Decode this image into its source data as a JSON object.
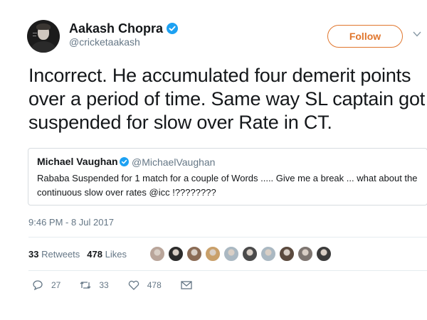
{
  "author": {
    "name": "Aakash Chopra",
    "handle": "@cricketaakash",
    "follow_label": "Follow"
  },
  "tweet": {
    "text": "Incorrect. He accumulated four demerit points over a period of time. Same way SL captain got suspended for slow over Rate in CT.",
    "timestamp": "9:46 PM - 8 Jul 2017"
  },
  "quoted": {
    "name": "Michael Vaughan",
    "handle": "@MichaelVaughan",
    "text": "Rababa Suspended for 1 match for a couple of Words ..... Give me a break ... what about the continuous slow over rates @icc !????????"
  },
  "stats": {
    "retweets_count": "33",
    "retweets_label": "Retweets",
    "likes_count": "478",
    "likes_label": "Likes"
  },
  "actions": {
    "reply_count": "27",
    "retweet_count": "33",
    "like_count": "478"
  },
  "colors": {
    "accent": "#e0762d",
    "verified": "#1da1f2",
    "secondary_text": "#657786"
  },
  "liker_colors": [
    "#b9a59a",
    "#2b2b2b",
    "#8a6b55",
    "#c9a06a",
    "#aab8c2",
    "#4a4a4a",
    "#aab8c2",
    "#5b4a3e",
    "#7d7570",
    "#3b3b3b"
  ]
}
